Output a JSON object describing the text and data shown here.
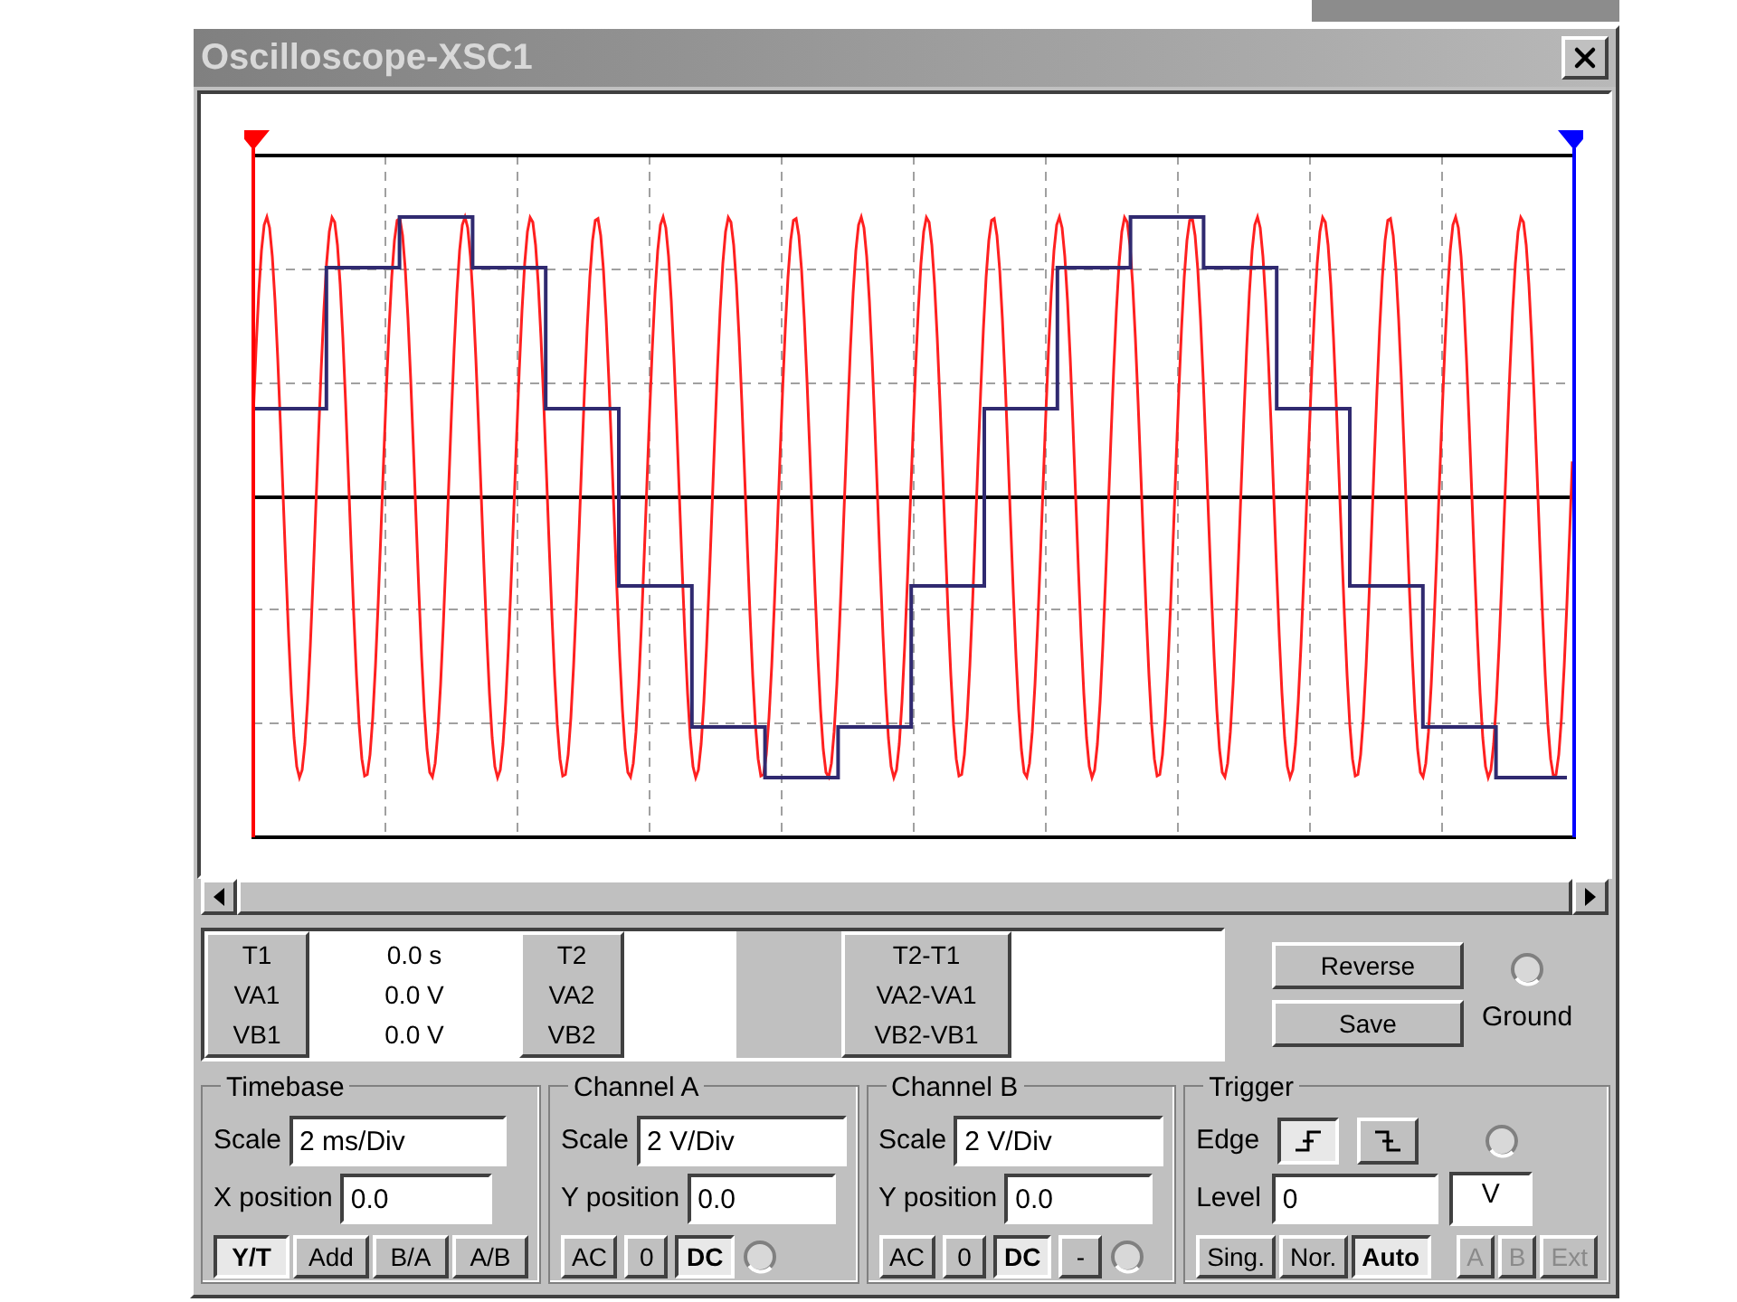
{
  "window": {
    "title": "Oscilloscope-XSC1"
  },
  "readouts": [
    {
      "labels": [
        "T1",
        "VA1",
        "VB1"
      ],
      "values": [
        "0.0 s",
        "0.0 V",
        "0.0 V"
      ]
    },
    {
      "labels": [
        "T2",
        "VA2",
        "VB2"
      ]
    },
    {
      "labels": [
        "T2-T1",
        "VA2-VA1",
        "VB2-VB1"
      ]
    }
  ],
  "buttons": [
    "Reverse",
    "Save"
  ],
  "ground": {
    "label": "Ground",
    "selected": false
  },
  "timebase": {
    "title": "Timebase",
    "fields": [
      {
        "label": "Scale",
        "value": "2 ms/Div"
      },
      {
        "label": "X position",
        "value": "0.0"
      }
    ],
    "modes": [
      {
        "label": "Y/T",
        "selected": true
      },
      {
        "label": "Add",
        "selected": false
      },
      {
        "label": "B/A",
        "selected": false
      },
      {
        "label": "A/B",
        "selected": false
      }
    ]
  },
  "channels": [
    {
      "title": "Channel A",
      "fields": [
        {
          "label": "Scale",
          "value": "2 V/Div"
        },
        {
          "label": "Y position",
          "value": "0.0"
        }
      ],
      "coupling": [
        {
          "label": "AC",
          "selected": false
        },
        {
          "label": "0",
          "selected": false
        },
        {
          "label": "DC",
          "selected": true
        }
      ],
      "radio_selected": false
    },
    {
      "title": "Channel B",
      "fields": [
        {
          "label": "Scale",
          "value": "2 V/Div"
        },
        {
          "label": "Y position",
          "value": "0.0"
        }
      ],
      "coupling": [
        {
          "label": "AC",
          "selected": false
        },
        {
          "label": "0",
          "selected": false
        },
        {
          "label": "DC",
          "selected": true
        },
        {
          "label": "-",
          "selected": false
        }
      ],
      "radio_selected": false
    }
  ],
  "trigger": {
    "title": "Trigger",
    "edge_label": "Edge",
    "edges": [
      {
        "kind": "rising",
        "selected": true
      },
      {
        "kind": "falling",
        "selected": false
      }
    ],
    "radio_selected": false,
    "level_label": "Level",
    "level_value": "0",
    "unit": "V",
    "modes": [
      {
        "label": "Sing.",
        "selected": false
      },
      {
        "label": "Nor.",
        "selected": false
      },
      {
        "label": "Auto",
        "selected": true
      }
    ],
    "sources": [
      {
        "label": "A",
        "disabled": true
      },
      {
        "label": "B",
        "disabled": true
      },
      {
        "label": "Ext",
        "disabled": true
      }
    ]
  }
}
